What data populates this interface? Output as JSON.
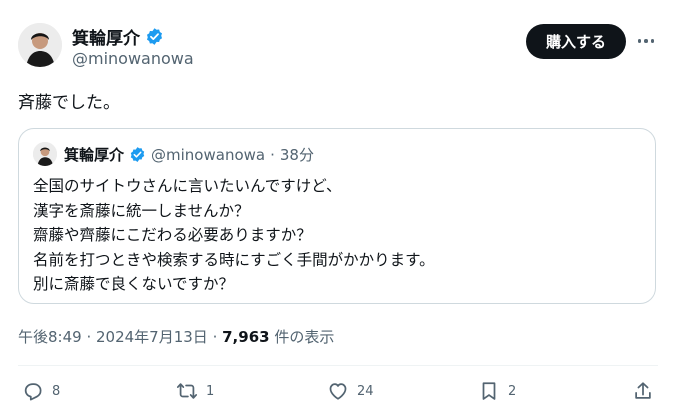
{
  "author": {
    "name": "箕輪厚介",
    "handle": "@minowanowa"
  },
  "buy_button": "購入する",
  "tweet_text": "斉藤でした。",
  "quote": {
    "name": "箕輪厚介",
    "handle": "@minowanowa",
    "separator": "·",
    "time": "38分",
    "lines": [
      "全国のサイトウさんに言いたいんですけど、",
      "漢字を斎藤に統一しませんか？",
      "齋藤や齊藤にこだわる必要ありますか？",
      "名前を打つときや検索する時にすごく手間がかかります。",
      "別に斎藤で良くないですか？"
    ]
  },
  "meta": {
    "time": "午後8:49",
    "sep1": " · ",
    "date": "2024年7月13日",
    "sep2": " · ",
    "views": "7,963",
    "views_label": " 件の表示"
  },
  "actions": {
    "replies": "8",
    "reposts": "1",
    "likes": "24",
    "bookmarks": "2"
  },
  "colors": {
    "verified": "#1d9bf0",
    "text": "#0f1419",
    "secondary": "#536471",
    "border": "#cfd9de"
  }
}
